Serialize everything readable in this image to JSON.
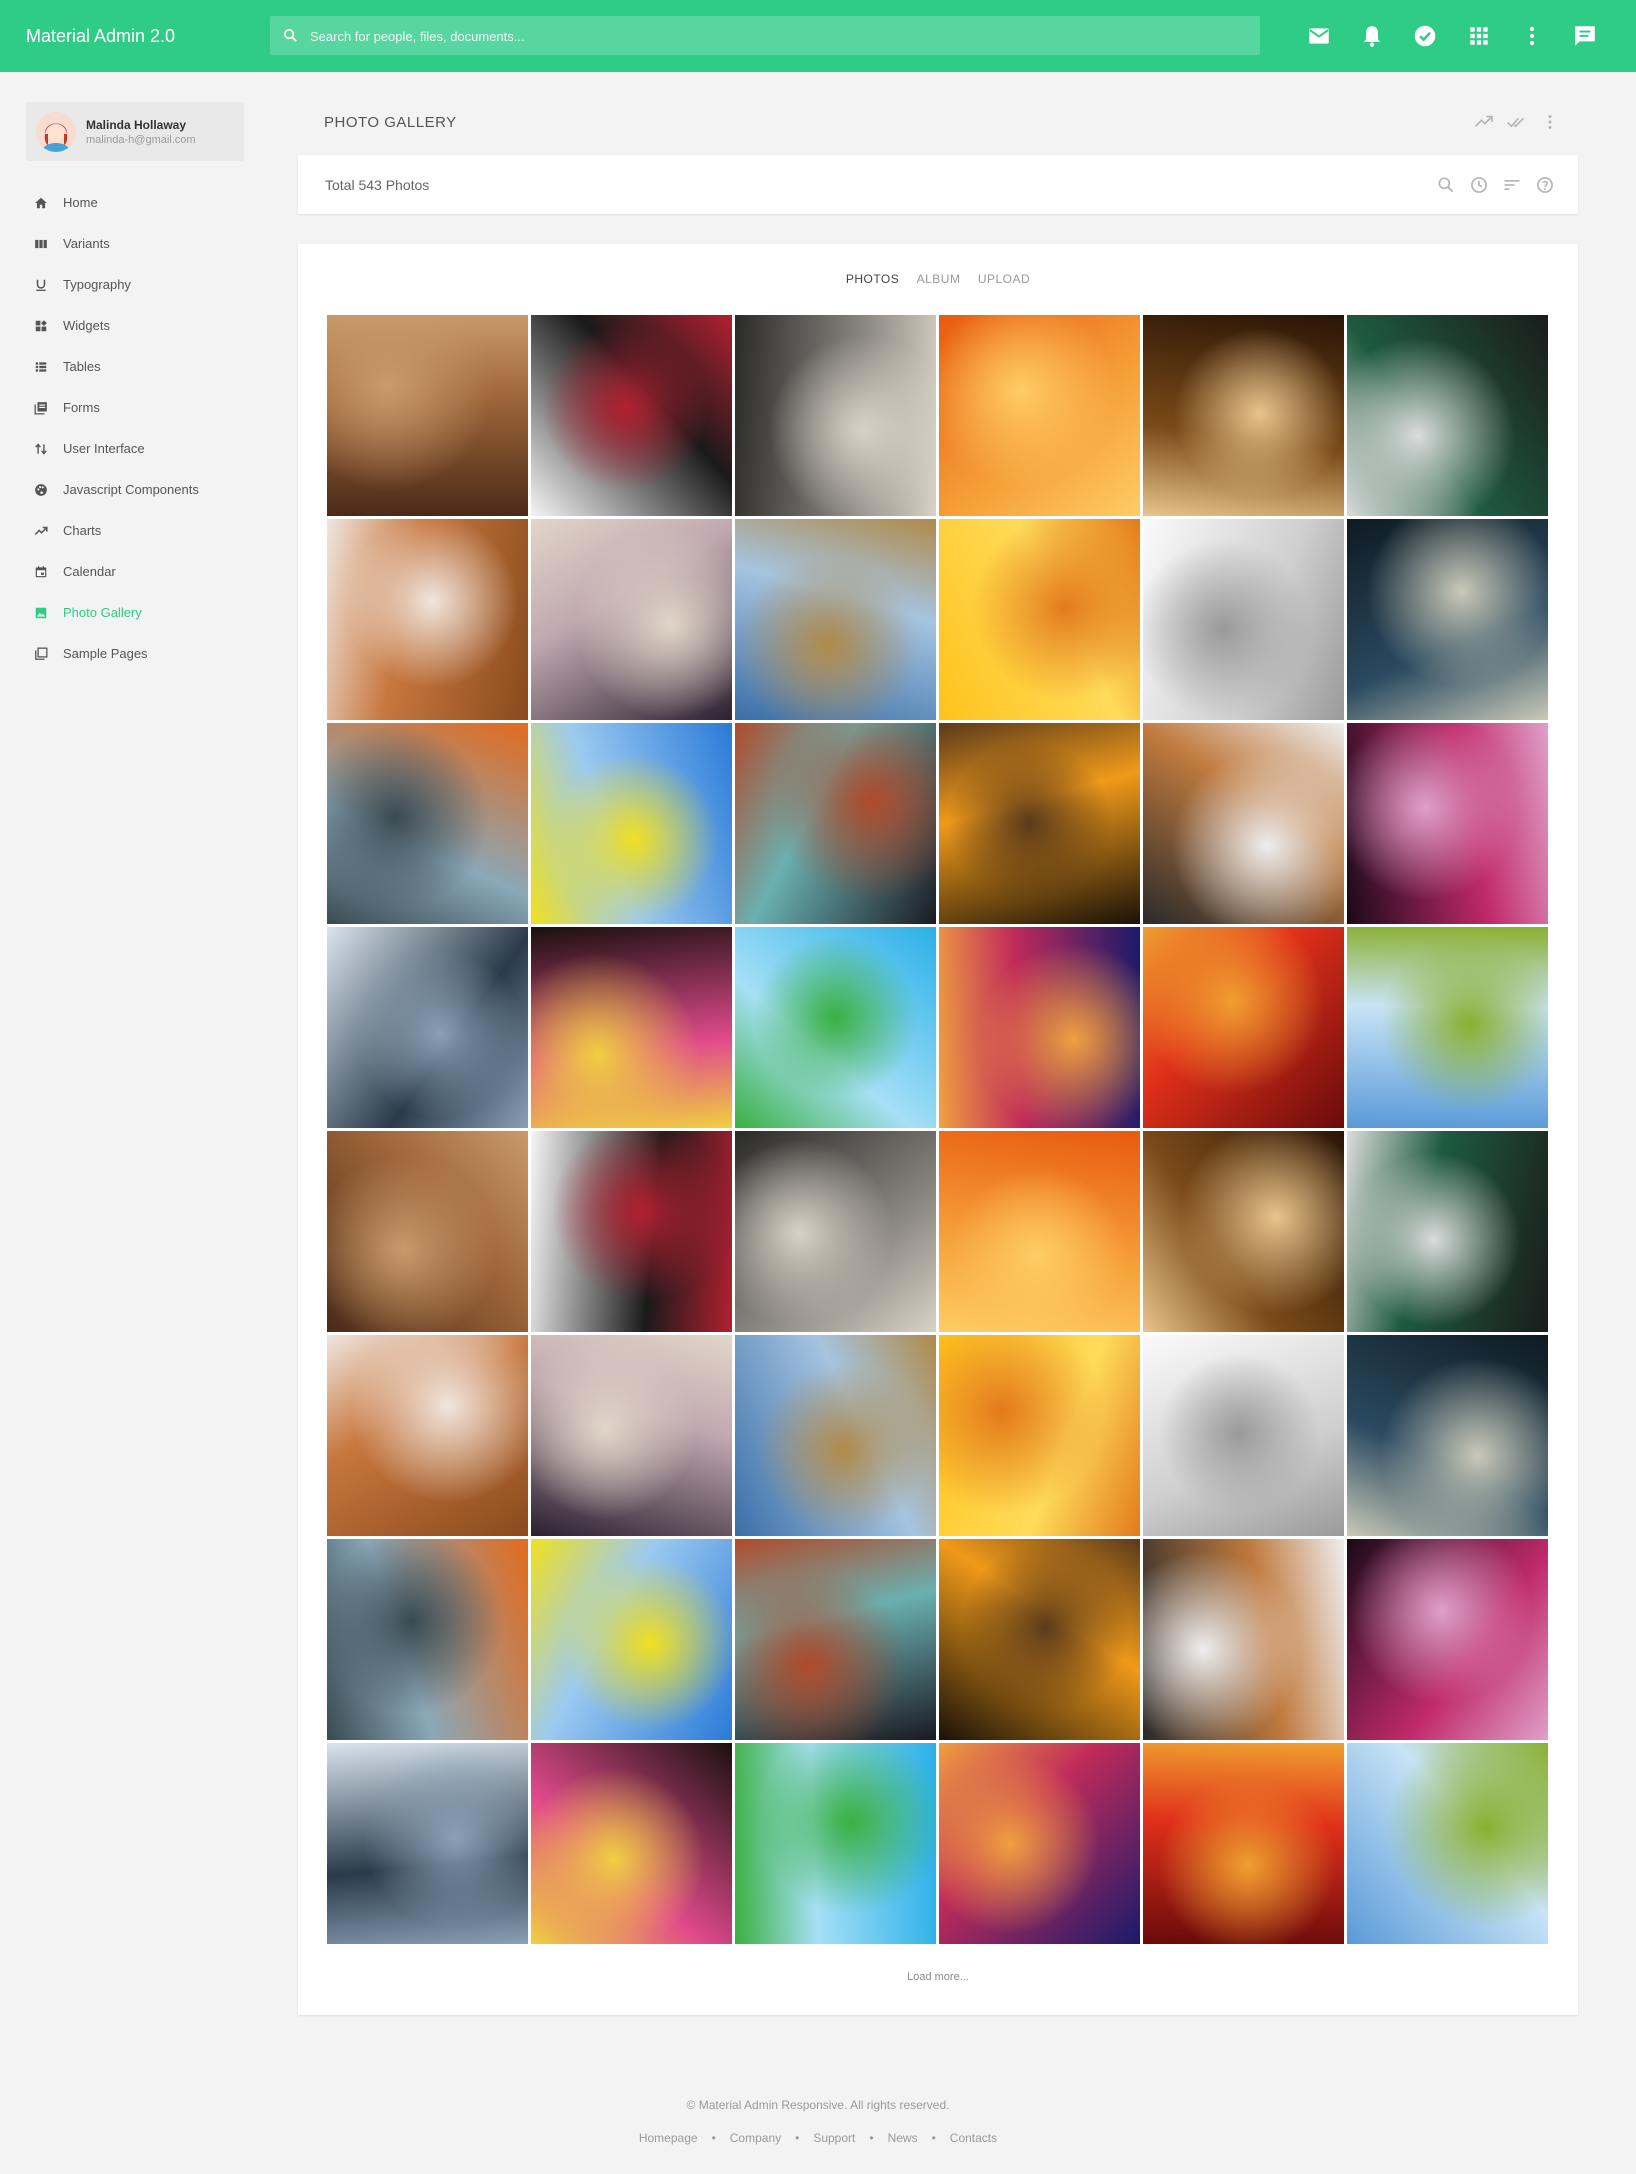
{
  "header": {
    "brand": "Material Admin 2.0",
    "search_placeholder": "Search for people, files, documents...",
    "icons": [
      "mail-icon",
      "bell-icon",
      "check-circle-icon",
      "apps-grid-icon",
      "more-vert-icon",
      "chat-icon"
    ],
    "color": "#2ecc87"
  },
  "profile": {
    "name": "Malinda Hollaway",
    "email": "malinda-h@gmail.com"
  },
  "sidebar": {
    "items": [
      {
        "label": "Home",
        "icon": "home-icon"
      },
      {
        "label": "Variants",
        "icon": "columns-icon"
      },
      {
        "label": "Typography",
        "icon": "underline-icon"
      },
      {
        "label": "Widgets",
        "icon": "widgets-icon"
      },
      {
        "label": "Tables",
        "icon": "table-list-icon"
      },
      {
        "label": "Forms",
        "icon": "forms-icon"
      },
      {
        "label": "User Interface",
        "icon": "swap-icon"
      },
      {
        "label": "Javascript Components",
        "icon": "palette-icon"
      },
      {
        "label": "Charts",
        "icon": "trending-icon"
      },
      {
        "label": "Calendar",
        "icon": "calendar-icon"
      },
      {
        "label": "Photo Gallery",
        "icon": "image-icon",
        "active": true
      },
      {
        "label": "Sample Pages",
        "icon": "pages-icon"
      }
    ]
  },
  "main": {
    "title": "PHOTO GALLERY",
    "total": "Total 543 Photos",
    "tabs": [
      {
        "label": "PHOTOS",
        "active": true
      },
      {
        "label": "ALBUM"
      },
      {
        "label": "UPLOAD"
      }
    ],
    "photos": [
      {
        "desc": "woman lying on sand",
        "colors": [
          "#4a2a18",
          "#a0673a",
          "#c99a6a"
        ]
      },
      {
        "desc": "girl with headphones",
        "colors": [
          "#f5f5f5",
          "#1a1a1a",
          "#b22030"
        ]
      },
      {
        "desc": "curly haired woman sepia",
        "colors": [
          "#2a2a28",
          "#8a8680",
          "#d8d2c6"
        ]
      },
      {
        "desc": "woman with leaf face paint",
        "colors": [
          "#e85a10",
          "#f6a23a",
          "#ffcc66"
        ]
      },
      {
        "desc": "chess pieces",
        "colors": [
          "#2a1506",
          "#7a4a18",
          "#e9c48c"
        ]
      },
      {
        "desc": "poker aces",
        "colors": [
          "#1b1b1b",
          "#1e5a40",
          "#dcdcdc"
        ]
      },
      {
        "desc": "hand on mouse",
        "colors": [
          "#8a4a1c",
          "#c7773e",
          "#f0e6df"
        ]
      },
      {
        "desc": "concert crowd",
        "colors": [
          "#2a2030",
          "#c0a8b0",
          "#e2d6c8"
        ]
      },
      {
        "desc": "girl with guitar in field",
        "colors": [
          "#3a6ea8",
          "#a6c4e0",
          "#b08a4a"
        ]
      },
      {
        "desc": "butterfly on yellow",
        "colors": [
          "#ffc21a",
          "#ffdb5a",
          "#e37a1c"
        ]
      },
      {
        "desc": "woman in white dress",
        "colors": [
          "#fafafa",
          "#cfcfcf",
          "#9a9a9a"
        ]
      },
      {
        "desc": "man with white cap",
        "colors": [
          "#0e1a22",
          "#2a4a60",
          "#c9c9b8"
        ]
      },
      {
        "desc": "colorful street",
        "colors": [
          "#e36a1c",
          "#8aa8b8",
          "#3a4a52"
        ]
      },
      {
        "desc": "hot air balloons",
        "colors": [
          "#2a7ad8",
          "#9ccaf0",
          "#f0e020"
        ]
      },
      {
        "desc": "girl at graffiti wall",
        "colors": [
          "#1a1a22",
          "#6ab0b0",
          "#b04a2a"
        ]
      },
      {
        "desc": "sunset reflection",
        "colors": [
          "#1a1208",
          "#f09a1a",
          "#5a3a1a"
        ]
      },
      {
        "desc": "hand on mouse",
        "colors": [
          "#2a2a2a",
          "#c07a3e",
          "#eeeeee"
        ]
      },
      {
        "desc": "woman with light streaks",
        "colors": [
          "#1a0a18",
          "#c02a6a",
          "#e0a0c8"
        ]
      },
      {
        "desc": "computer lab",
        "colors": [
          "#d8e4ee",
          "#2a3a4a",
          "#8aa0b6"
        ]
      },
      {
        "desc": "bokeh lights",
        "colors": [
          "#1a1010",
          "#e04a8a",
          "#f0d040"
        ]
      },
      {
        "desc": "boy on pencil",
        "colors": [
          "#2ab0e8",
          "#a6e0f6",
          "#3ab040"
        ]
      },
      {
        "desc": "city night skyline",
        "colors": [
          "#1a1a6a",
          "#c02a5a",
          "#f0a040"
        ]
      },
      {
        "desc": "red sky over lake",
        "colors": [
          "#6a0a0a",
          "#e0301a",
          "#f0a030"
        ]
      },
      {
        "desc": "green meadow",
        "colors": [
          "#5a9ad8",
          "#c8e4f6",
          "#8ab030"
        ]
      }
    ],
    "load_more": "Load more..."
  },
  "footer": {
    "copyright": "© Material Admin Responsive. All rights reserved.",
    "links": [
      "Homepage",
      "Company",
      "Support",
      "News",
      "Contacts"
    ]
  }
}
